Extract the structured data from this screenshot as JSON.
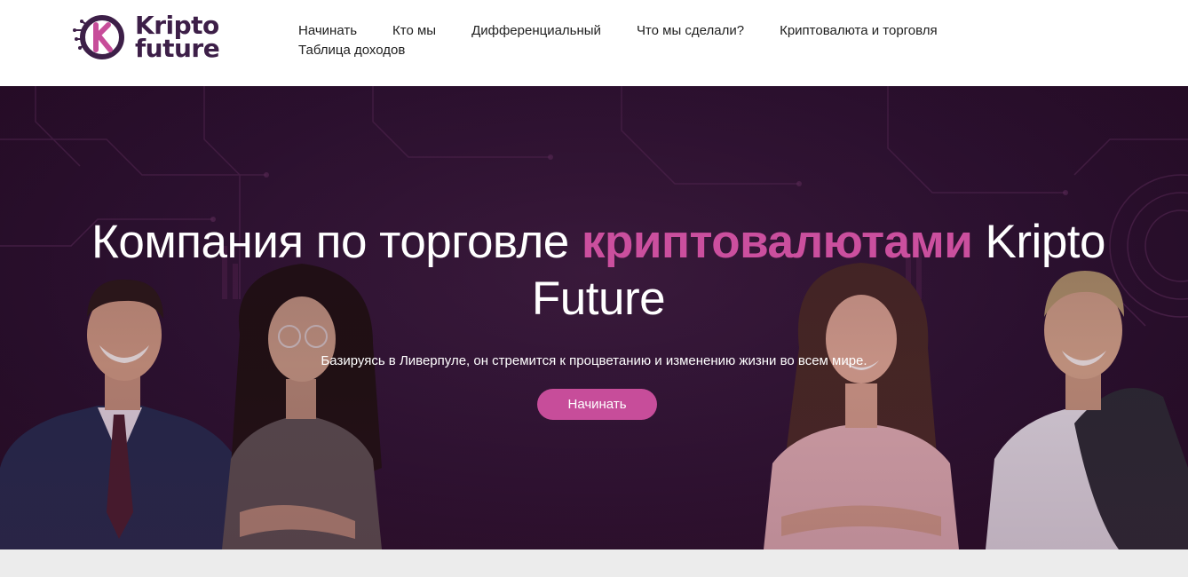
{
  "brand": {
    "logo_line1": "Kripto",
    "logo_line2": "future",
    "colors": {
      "brand_dark": "#3d1f48",
      "accent_pink": "#c74d9a",
      "hero_bg": "#2b1130"
    }
  },
  "nav": {
    "items": [
      {
        "label": "Начинать"
      },
      {
        "label": "Кто мы"
      },
      {
        "label": "Дифференциальный"
      },
      {
        "label": "Что мы сделали?"
      },
      {
        "label": "Криптовалюта и торговля"
      },
      {
        "label": "Таблица доходов"
      }
    ]
  },
  "hero": {
    "title_part1": "Компания по торговле ",
    "title_highlight": "криптовалютами",
    "title_part2": " Kripto Future",
    "subtitle": "Базируясь в Ливерпуле, он стремится к процветанию и изменению жизни во всем мире.",
    "cta_label": "Начинать"
  }
}
